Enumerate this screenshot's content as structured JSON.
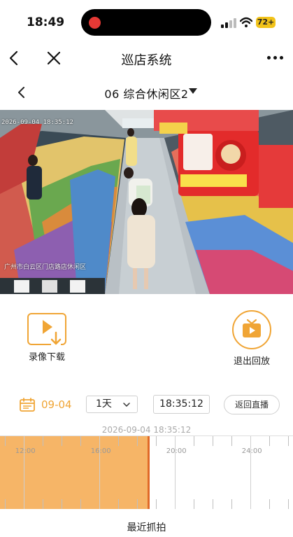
{
  "status_bar": {
    "time": "18:49",
    "battery": "72+"
  },
  "nav": {
    "title": "巡店系统"
  },
  "channel": {
    "name": "06 综合休闲区2"
  },
  "video": {
    "osd_timestamp": "2026-09-04 18:35:12",
    "osd_location": "广州市白云区门店路店休闲区"
  },
  "actions": {
    "download_label": "录像下载",
    "exit_playback_label": "退出回放"
  },
  "controls": {
    "date": "09-04",
    "speed": "1天",
    "time": "18:35:12",
    "live_label": "返回直播"
  },
  "timeline": {
    "current_datetime": "2026-09-04 18:35:12",
    "tick_labels": [
      "12:00",
      "16:00",
      "20:00",
      "24:00"
    ],
    "recorded_until": "18:35:12"
  },
  "footer": {
    "recent_label": "最近抓拍"
  },
  "colors": {
    "accent": "#f0a535",
    "timeline_fill": "#f6b567",
    "cursor": "#e06a28"
  }
}
